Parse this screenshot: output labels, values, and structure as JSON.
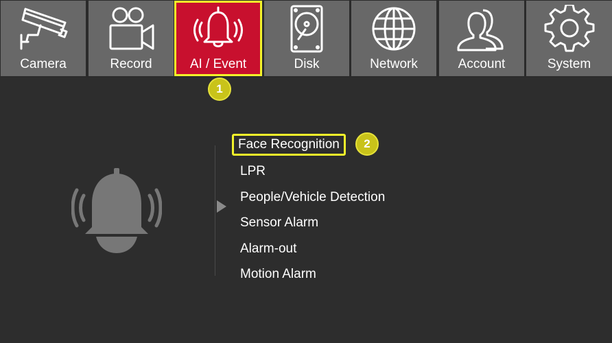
{
  "navbar": {
    "tabs": [
      {
        "id": "camera",
        "label": "Camera",
        "icon": "camera-icon"
      },
      {
        "id": "record",
        "label": "Record",
        "icon": "video-camera-icon"
      },
      {
        "id": "ai",
        "label": "AI / Event",
        "icon": "bell-icon",
        "active": true
      },
      {
        "id": "disk",
        "label": "Disk",
        "icon": "hard-disk-icon"
      },
      {
        "id": "network",
        "label": "Network",
        "icon": "globe-icon"
      },
      {
        "id": "account",
        "label": "Account",
        "icon": "users-icon"
      },
      {
        "id": "system",
        "label": "System",
        "icon": "gear-icon"
      }
    ]
  },
  "badges": {
    "step1": "1",
    "step2": "2"
  },
  "submenu": {
    "items": [
      {
        "label": "Face Recognition",
        "highlighted": true
      },
      {
        "label": "LPR"
      },
      {
        "label": "People/Vehicle Detection"
      },
      {
        "label": "Sensor Alarm"
      },
      {
        "label": "Alarm-out"
      },
      {
        "label": "Motion Alarm"
      }
    ]
  },
  "colors": {
    "background": "#2d2d2d",
    "tab_inactive": "#686868",
    "tab_active": "#c8102e",
    "highlight": "#f3f32a",
    "badge": "#c9c31a",
    "bell_decor": "#777777"
  }
}
